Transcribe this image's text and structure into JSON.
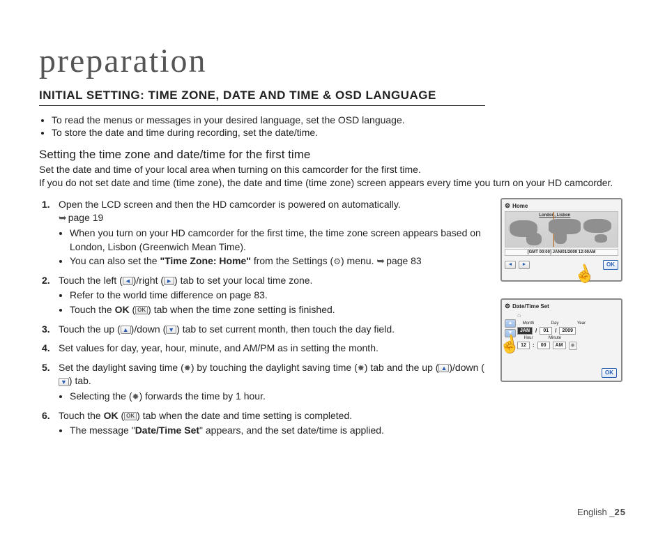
{
  "page_title": "preparation",
  "section_heading": "INITIAL SETTING: TIME ZONE, DATE AND TIME & OSD LANGUAGE",
  "intro_bullets": [
    "To read the menus or messages in your desired language, set the OSD language.",
    "To store the date and time during recording, set the date/time."
  ],
  "sub_heading": "Setting the time zone and date/time for the first time",
  "sub_desc": "Set the date and time of your local area when turning on this camcorder for the first time.\nIf you do not set date and time (time zone), the date and time (time zone) screen appears every time you turn on your HD camcorder.",
  "steps": {
    "s1": {
      "text_a": "Open the LCD screen and then the HD camcorder is powered on automatically.",
      "ref1": "page 19",
      "b1": "When you turn on your HD camcorder for the first time, the time zone screen appears based on London, Lisbon (Greenwich Mean Time).",
      "b2_a": "You can also set the ",
      "b2_bold": "\"Time Zone: Home\"",
      "b2_b": " from the Settings (",
      "b2_c": ") menu. ",
      "ref2": "page 83"
    },
    "s2": {
      "text_a": "Touch the left (",
      "text_b": ")/right (",
      "text_c": ") tab to set your local time zone.",
      "b1": "Refer to the world time difference on page 83.",
      "b2_a": "Touch the ",
      "b2_bold": "OK",
      "b2_b": " (",
      "b2_c": ") tab when the time zone setting is finished."
    },
    "s3": {
      "text_a": "Touch the up (",
      "text_b": ")/down (",
      "text_c": ") tab to set current month, then touch the day field."
    },
    "s4": "Set values for day, year, hour, minute, and AM/PM as in setting the month.",
    "s5": {
      "text_a": "Set the daylight saving time (",
      "text_b": ") by touching the daylight saving time (",
      "text_c": ") tab and the up (",
      "text_d": ")/down (",
      "text_e": ") tab.",
      "b1_a": "Selecting the (",
      "b1_b": ") forwards the time by 1 hour."
    },
    "s6": {
      "text_a": "Touch the ",
      "text_bold": "OK",
      "text_b": " (",
      "text_c": ") tab when the date and time setting is completed.",
      "b1_a": "The message \"",
      "b1_bold": "Date/Time Set",
      "b1_b": "\" appears, and the set date/time is applied."
    }
  },
  "screen1": {
    "title": "Home",
    "city": "London, Lisbon",
    "gmt": "[GMT 00:00] JAN/01/2009 12:00AM",
    "left": "◄",
    "right": "►",
    "ok": "OK"
  },
  "screen2": {
    "title": "Date/Time Set",
    "labels": {
      "month": "Month",
      "day": "Day",
      "year": "Year",
      "hour": "Hour",
      "minute": "Minute"
    },
    "values": {
      "month": "JAN",
      "day": "01",
      "year": "2009",
      "hour": "12",
      "minute": "00",
      "ampm": "AM"
    },
    "slash": "/",
    "colon": ":",
    "up": "▲",
    "down": "▼",
    "ok": "OK"
  },
  "icons": {
    "gear": "⚙",
    "left": "◄",
    "right": "►",
    "up": "▲",
    "down": "▼",
    "ok": "OK",
    "dst": "✹",
    "home": "⌂"
  },
  "footer": {
    "lang": "English ",
    "sep": "_",
    "page": "25"
  }
}
